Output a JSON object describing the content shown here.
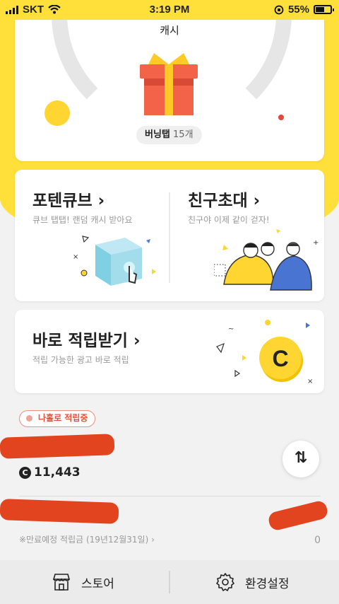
{
  "status_bar": {
    "carrier": "SKT",
    "time": "3:19 PM",
    "battery": "55%"
  },
  "cash_card": {
    "label": "캐시",
    "burn_tap_label": "버닝탭",
    "burn_tap_count": "15개"
  },
  "features": [
    {
      "title": "포텐큐브",
      "subtitle": "큐브 탭탭! 랜덤 캐시 받아요"
    },
    {
      "title": "친구초대",
      "subtitle": "친구야 이제 같이 걷자!"
    },
    {
      "title": "바로 적립받기",
      "subtitle": "적립 가능한 광고 바로 적립"
    }
  ],
  "coin_letter": "C",
  "saving_badge": "나홀로 적립중",
  "balance": "11,443",
  "expiring": {
    "label": "※만료예정 적립금 (19년12월31일)",
    "value": "0"
  },
  "tabs": [
    {
      "label": "스토어"
    },
    {
      "label": "환경설정"
    }
  ],
  "icons": [
    "wifi-icon",
    "gift-icon",
    "cube-icon",
    "friends-icon",
    "coin-icon",
    "swap-icon",
    "store-icon",
    "gear-icon"
  ],
  "colors": {
    "brand_yellow": "#ffe03a",
    "accent_red": "#e2533c",
    "gift_red": "#f2634a"
  }
}
